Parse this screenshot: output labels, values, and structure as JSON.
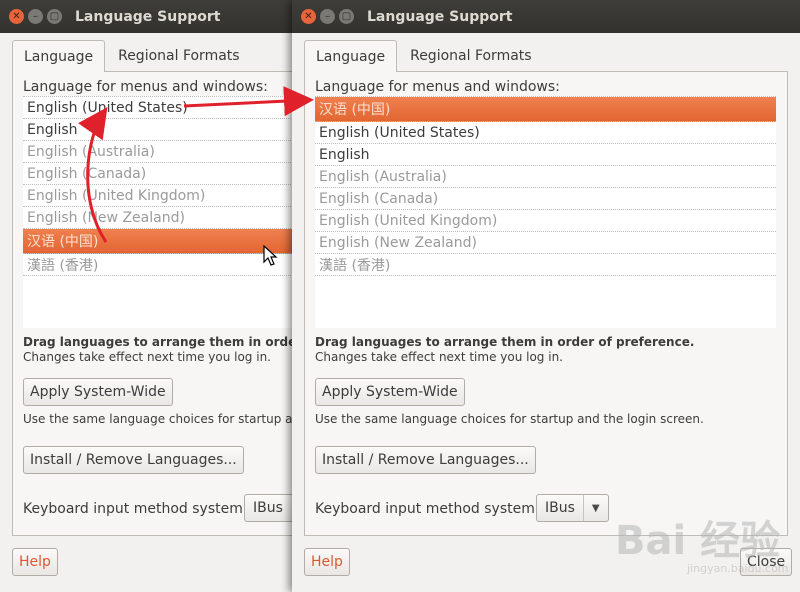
{
  "window": {
    "title": "Language Support"
  },
  "tabs": {
    "language": "Language",
    "regional": "Regional Formats"
  },
  "language_label": "Language for menus and windows:",
  "back_languages": [
    {
      "label": "English (United States)"
    },
    {
      "label": "English"
    },
    {
      "label": "English (Australia)"
    },
    {
      "label": "English (Canada)"
    },
    {
      "label": "English (United Kingdom)"
    },
    {
      "label": "English (New Zealand)"
    },
    {
      "label": "汉语 (中国)"
    },
    {
      "label": "漢語 (香港)"
    }
  ],
  "front_languages": [
    {
      "label": "汉语 (中国)"
    },
    {
      "label": "English (United States)"
    },
    {
      "label": "English"
    },
    {
      "label": "English (Australia)"
    },
    {
      "label": "English (Canada)"
    },
    {
      "label": "English (United Kingdom)"
    },
    {
      "label": "English (New Zealand)"
    },
    {
      "label": "漢語 (香港)"
    }
  ],
  "drag_hint": "Drag languages to arrange them in order of preference.",
  "changes_hint": "Changes take effect next time you log in.",
  "apply_button": "Apply System-Wide",
  "same_choices": "Use the same language choices for startup and the login screen.",
  "install_button": "Install / Remove Languages...",
  "keyboard_label": "Keyboard input method system:",
  "keyboard_value": "IBus",
  "help_button": "Help",
  "close_button": "Close",
  "watermark": {
    "brand": "Bai 经验",
    "url": "jingyan.baidu.com"
  },
  "colors": {
    "selection": "#e8703c",
    "titlebar": "#3c3b37",
    "arrow": "#e0202a",
    "help_text": "#e0572f"
  }
}
